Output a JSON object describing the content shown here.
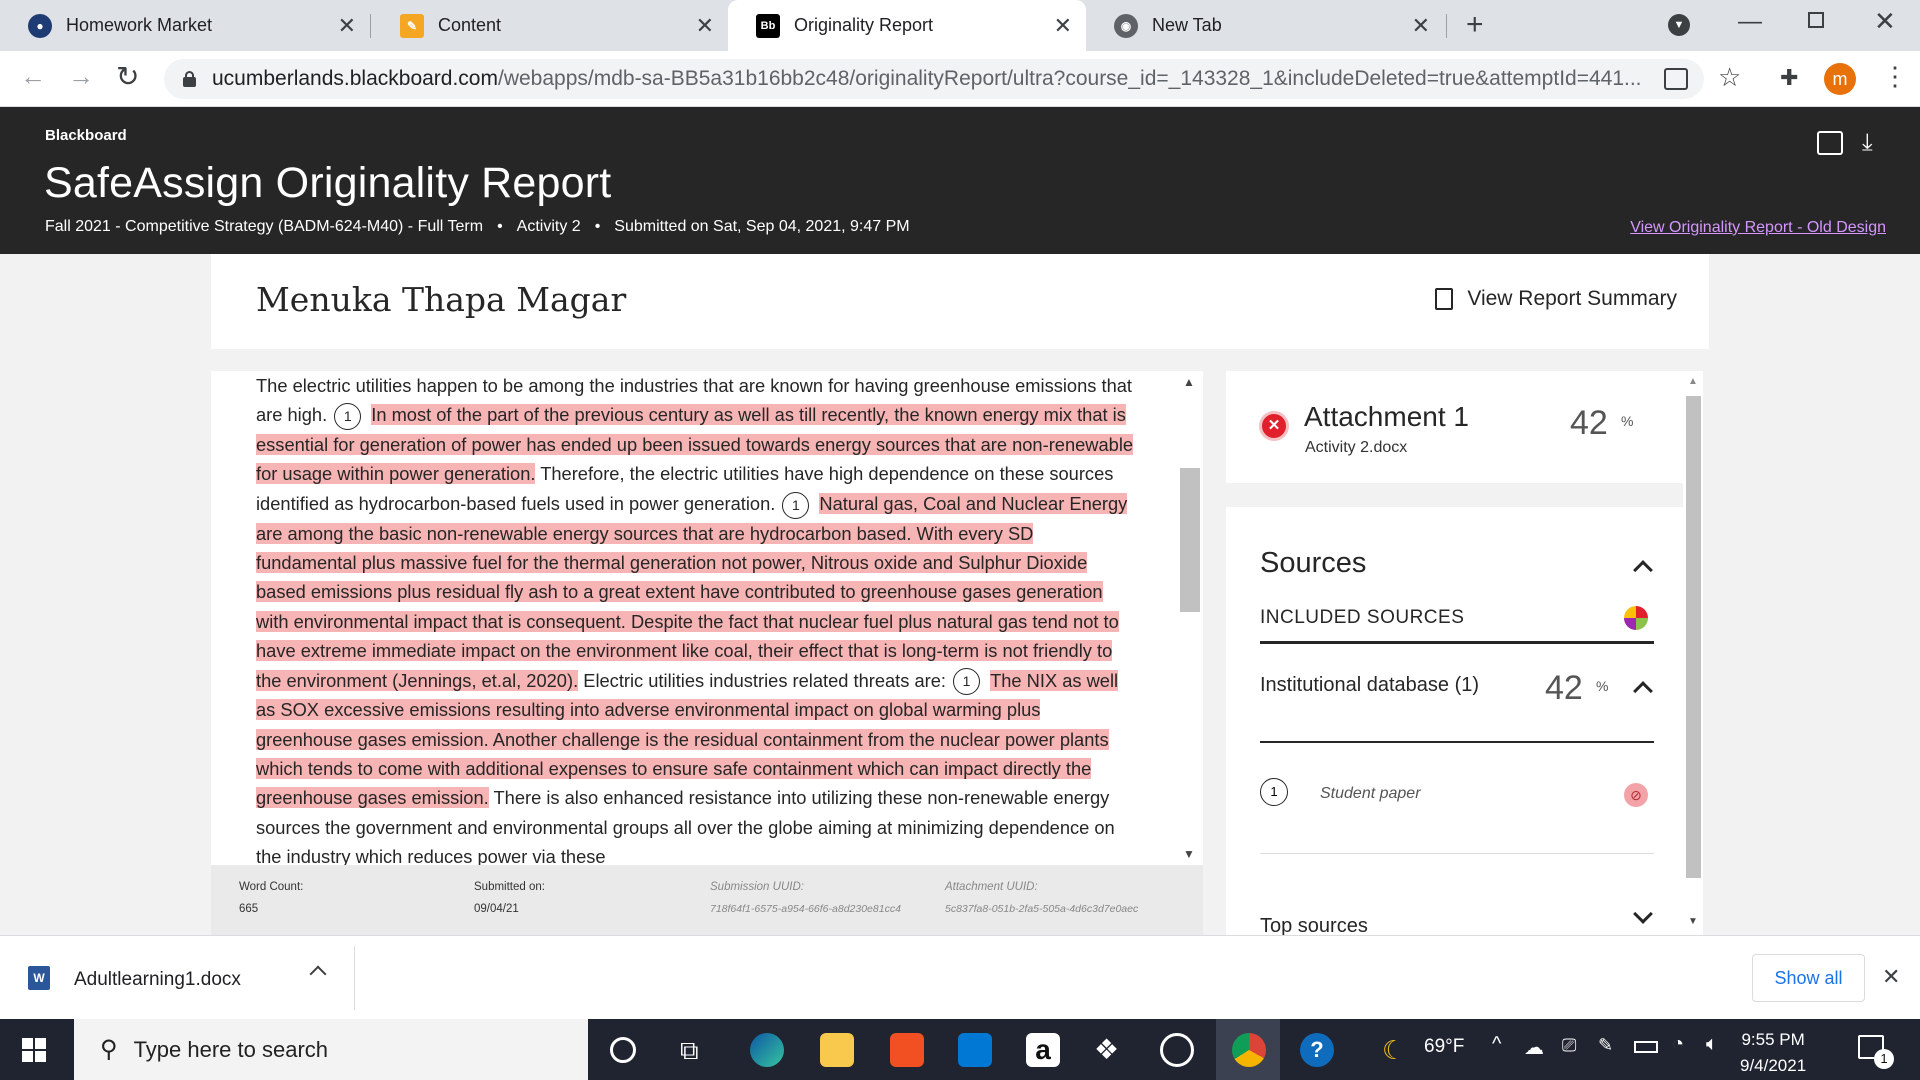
{
  "browser": {
    "tabs": [
      {
        "label": "Homework Market",
        "active": false
      },
      {
        "label": "Content",
        "active": false
      },
      {
        "label": "Originality Report",
        "active": true
      },
      {
        "label": "New Tab",
        "active": false
      }
    ],
    "url_host": "ucumberlands.blackboard.com",
    "url_path": "/webapps/mdb-sa-BB5a31b16bb2c48/originalityReport/ultra?course_id=_143328_1&includeDeleted=true&attemptId=441...",
    "profile_initial": "m"
  },
  "header": {
    "brand": "Blackboard",
    "title": "SafeAssign Originality Report",
    "course": "Fall 2021 - Competitive Strategy (BADM-624-M40) - Full Term",
    "sep1": "•",
    "activity": "Activity 2",
    "sep2": "•",
    "submitted": "Submitted on Sat, Sep 04, 2021, 9:47 PM",
    "old_design_link": "View Originality Report - Old Design"
  },
  "paper": {
    "student_name": "Menuka Thapa Magar",
    "view_summary": "View Report Summary",
    "text": {
      "t1": "The electric utilities happen to be among the industries that are known for having greenhouse emissions that are high.",
      "b1": "1",
      "h1": "In most of the part of the previous century as well as till recently, the known energy mix that is essential for generation of power has ended up been issued towards energy sources that are non-renewable for usage within power generation.",
      "t2": "Therefore, the electric utilities have high dependence on these sources identified as hydrocarbon-based fuels used in power generation.",
      "b2": "1",
      "h2": "Natural gas, Coal and Nuclear Energy are among the basic non-renewable energy sources that are hydrocarbon based. With every SD fundamental plus massive fuel for the thermal generation not power, Nitrous ox­ide and Sulphur Dioxide based emissions plus residual fly ash to a great extent have contributed to greenhouse gases generation with environmental impact that is consequent. Despite the fact that nuc­lear fuel plus natural gas tend not to have extreme immediate impact on the environment like coal, their effect that is long-term is not friendly to the environment (Jennings, et.al, 2020).",
      "t3": "Electric utilities indus­tries related threats are:",
      "b3": "1",
      "h3": "The NIX as well as SOX excessive emissions resulting into adverse environ­mental impact on global warming plus greenhouse gases emission. Another challenge is the residual containment from the nuclear power plants which tends to come with additional expenses to ensure safe containment which can impact directly the greenhouse gases emission.",
      "t4": "There is also enhanced res­istance into utilizing these non-renewable energy sources the government and environmental groups all over the globe aiming at minimizing dependence on the industry which reduces power via these"
    },
    "footer": {
      "word_count_label": "Word Count:",
      "word_count": "665",
      "submitted_label": "Submitted on:",
      "submitted": "09/04/21",
      "sub_uuid_label": "Submission UUID:",
      "sub_uuid": "718f64f1-6575-a954-66f6-a8d230e81cc4",
      "att_uuid_label": "Attachment UUID:",
      "att_uuid": "5c837fa8-051b-2fa5-505a-4d6c3d7e0aec"
    }
  },
  "sidebar": {
    "attachment_title": "Attachment 1",
    "attachment_file": "Activity 2.docx",
    "attachment_pct": "42",
    "pct_symbol": "%",
    "sources_title": "Sources",
    "included_title": "INCLUDED SOURCES",
    "institutional_title": "Institutional database (1)",
    "institutional_pct": "42",
    "source_number": "1",
    "source_label": "Student paper",
    "top_sources": "Top sources"
  },
  "downloads": {
    "file": "Adultlearning1.docx",
    "show_all": "Show all"
  },
  "taskbar": {
    "search_placeholder": "Type here to search",
    "weather": "69°F",
    "time": "9:55 PM",
    "date": "9/4/2021",
    "notifications": "1"
  },
  "colors": {
    "highlight": "#f7b4b4",
    "header_bg": "#262626",
    "old_design_link": "#d596ff",
    "error_red": "#e0202c"
  }
}
